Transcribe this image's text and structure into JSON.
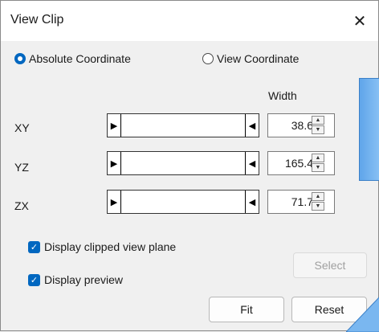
{
  "window": {
    "title": "View Clip",
    "close_glyph": "✕"
  },
  "coordinate_mode": {
    "options": [
      {
        "label": "Absolute Coordinate",
        "selected": true
      },
      {
        "label": "View Coordinate",
        "selected": false
      }
    ]
  },
  "clip_table": {
    "width_header": "Width",
    "rows": [
      {
        "label": "XY",
        "width": "38.6"
      },
      {
        "label": "YZ",
        "width": "165.4"
      },
      {
        "label": "ZX",
        "width": "71.7"
      }
    ]
  },
  "options": {
    "display_clipped_view_plane": {
      "label": "Display clipped view plane",
      "checked": true
    },
    "display_preview": {
      "label": "Display preview",
      "checked": true
    }
  },
  "buttons": {
    "select": "Select",
    "fit": "Fit",
    "reset": "Reset"
  },
  "icons": {
    "slider_left": "triangle-right-icon",
    "slider_right": "triangle-left-icon",
    "spin_up": "caret-up-icon",
    "spin_down": "caret-down-icon",
    "check": "check-icon",
    "close": "close-icon"
  },
  "colors": {
    "accent": "#0067c0",
    "preview_fill": "#7ab7f0",
    "background": "#f0f0f0"
  }
}
